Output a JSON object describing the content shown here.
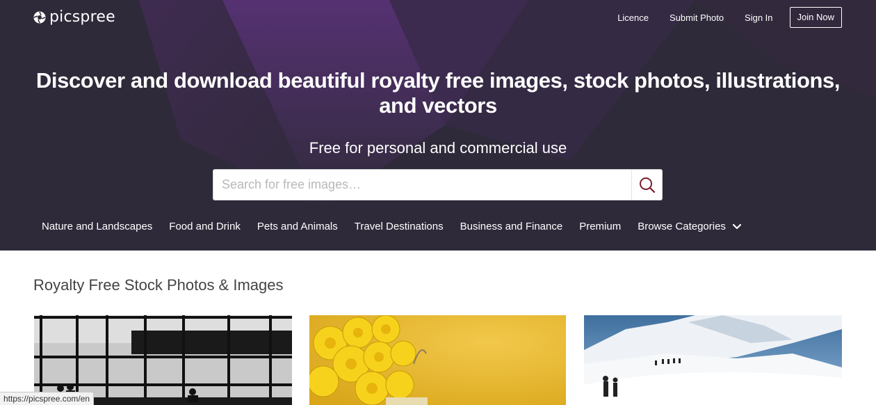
{
  "brand": {
    "name": "picspree",
    "accent": "#7a1e2b",
    "hero_bg": "#2f2a3a"
  },
  "nav": {
    "licence": "Licence",
    "submit_photo": "Submit Photo",
    "sign_in": "Sign In",
    "join_now": "Join Now"
  },
  "hero": {
    "headline_line1": "Discover and download beautiful royalty free images, stock photos, illustrations,",
    "headline_line2": "and vectors",
    "subline": "Free for personal and commercial use"
  },
  "search": {
    "placeholder": "Search for free images…",
    "icon": "search-icon"
  },
  "categories": [
    "Nature and Landscapes",
    "Food and Drink",
    "Pets and Animals",
    "Travel Destinations",
    "Business and Finance",
    "Premium"
  ],
  "browse_categories": {
    "label": "Browse Categories",
    "icon": "chevron-down-icon"
  },
  "gallery": {
    "title": "Royalty Free Stock Photos & Images",
    "photos": [
      "airport-silhouette-photo",
      "yellow-flowers-photo",
      "snow-mountain-hikers-photo"
    ]
  },
  "status_bar": {
    "url": "https://picspree.com/en"
  }
}
